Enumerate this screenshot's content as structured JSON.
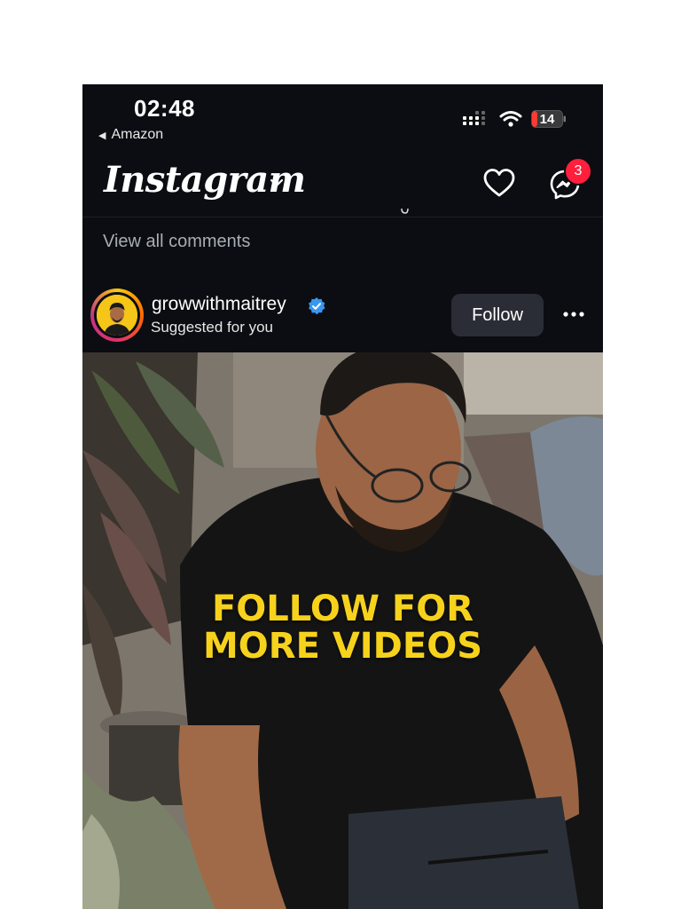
{
  "status_bar": {
    "time": "02:48",
    "back_app": "Amazon",
    "battery": "14"
  },
  "header": {
    "logo": "Instagram",
    "notification_badge": "3"
  },
  "feed": {
    "view_comments": "View all comments"
  },
  "post": {
    "username": "growwithmaitrey",
    "subtitle": "Suggested for you",
    "follow_label": "Follow",
    "caption_line1": "FOLLOW FOR",
    "caption_line2": "MORE VIDEOS"
  },
  "colors": {
    "background": "#0b0d12",
    "badge": "#ff1f3d",
    "verified": "#3897f0",
    "caption": "#f7d21c"
  }
}
